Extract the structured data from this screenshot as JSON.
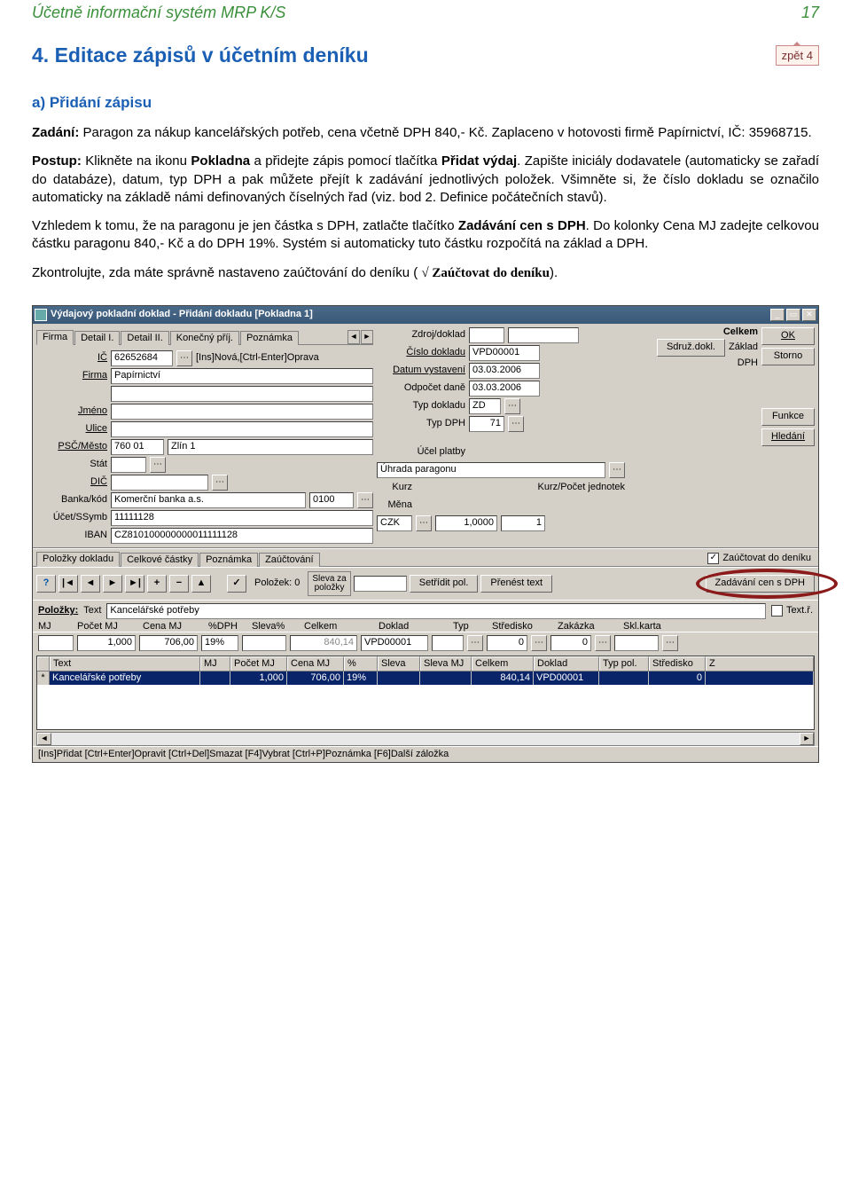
{
  "header": {
    "title": "Účetně informační systém MRP K/S",
    "page": "17"
  },
  "section": "4. Editace zápisů v účetním deníku",
  "back_btn": "zpět 4",
  "subsection": "a) Přidání zápisu",
  "para1_prefix": "Zadání:",
  "para1_body": " Paragon za nákup kancelářských potřeb, cena včetně DPH 840,- Kč. Zaplaceno v hotovosti firmě Papírnictví, IČ: 35968715.",
  "para2_prefix": "Postup:",
  "para2_a": " Klikněte na ikonu ",
  "para2_b": "Pokladna",
  "para2_c": " a přidejte zápis pomocí tlačítka ",
  "para2_d": "Přidat výdaj",
  "para2_e": ". Zapište iniciály dodavatele (automaticky se zařadí do databáze), datum, typ DPH a pak můžete přejít k zadávání jednotlivých položek. Všimněte si, že číslo dokladu se označilo automaticky na základě námi definovaných číselných řad (viz. bod 2. Definice počátečních stavů).",
  "para3_a": "Vzhledem k tomu, že na paragonu je jen částka s DPH, zatlačte tlačítko ",
  "para3_b": "Zadávání cen s DPH",
  "para3_c": ". Do kolonky Cena MJ zadejte celkovou částku paragonu 840,- Kč  a  do DPH 19%. Systém  si automaticky tuto částku rozpočítá na základ a DPH.",
  "para4_a": "Zkontrolujte, zda máte správně nastaveno zaúčtování do deníku ( ",
  "para4_b": "√ Zaúčtovat do deníku",
  "para4_c": ").",
  "win": {
    "title": "Výdajový pokladní doklad - Přidání dokladu  [Pokladna 1]",
    "tabs1": [
      "Firma",
      "Detail I.",
      "Detail II.",
      "Konečný příj.",
      "Poznámka"
    ],
    "left": {
      "ic_label": "IČ",
      "ic": "62652684",
      "ic_hint": "[Ins]Nová,[Ctrl-Enter]Oprava",
      "firma_label": "Firma",
      "firma": "Papírnictví",
      "jmeno_label": "Jméno",
      "jmeno": "",
      "ulice_label": "Ulice",
      "ulice": "",
      "psc_label": "PSČ/Město",
      "psc": "760 01",
      "mesto": "Zlín 1",
      "stat_label": "Stát",
      "stat": "",
      "dic_label": "DIČ",
      "dic": "",
      "banka_label": "Banka/kód",
      "banka": "Komerční banka a.s.",
      "kod": "0100",
      "ucet_label": "Účet/SSymb",
      "ucet": "11111128",
      "iban_label": "IBAN",
      "iban": "CZ810100000000011111128"
    },
    "mid": {
      "zdroj_label": "Zdroj/doklad",
      "cislo_label": "Číslo dokladu",
      "cislo": "VPD00001",
      "datum_label": "Datum vystavení",
      "datum": "03.03.2006",
      "odpocet_label": "Odpočet daně",
      "odpocet": "03.03.2006",
      "typdok_label": "Typ dokladu",
      "typdok": "ZD",
      "typdph_label": "Typ DPH",
      "typdph": "71",
      "ucel_label": "Účel platby",
      "ucel": "Úhrada paragonu",
      "kurz_label": "Kurz",
      "kurz_hint": "Kurz/Počet jednotek",
      "mena_label": "Měna",
      "mena": "CZK",
      "kurz": "1,0000",
      "kurz_units": "1"
    },
    "right": {
      "celkem": "Celkem",
      "sdruz": "Sdruž.dokl.",
      "zaklad": "Základ",
      "dph": "DPH",
      "ok": "OK",
      "storno": "Storno",
      "funkce": "Funkce",
      "hledani": "Hledání"
    },
    "tabs2": [
      "Položky dokladu",
      "Celkové částky",
      "Poznámka",
      "Zaúčtování"
    ],
    "zauctovat_lbl": "Zaúčtovat do deníku",
    "toolbar": {
      "polozek_lbl": "Položek:",
      "polozek": "0",
      "sleva_lbl1": "Sleva za",
      "sleva_lbl2": "položky",
      "setridit": "Setřídit pol.",
      "prenest": "Přenést text",
      "zadavani": "Zadávání cen s DPH"
    },
    "polozky": {
      "label": "Položky:",
      "sub": "Text",
      "text": "Kancelářské potřeby",
      "textr": "Text.ř."
    },
    "num_head": [
      "MJ",
      "Počet MJ",
      "Cena MJ",
      "%DPH",
      "Sleva%",
      "Celkem",
      "Doklad",
      "Typ",
      "Středisko",
      "Zakázka",
      "Skl.karta"
    ],
    "num_vals": {
      "mj": "",
      "pocet": "1,000",
      "cena": "706,00",
      "dph": "19%",
      "sleva": "",
      "celkem": "840,14",
      "doklad": "VPD00001",
      "typ": "",
      "stred": "0",
      "zak": "0",
      "skl": ""
    },
    "grid_head": [
      "",
      "Text",
      "MJ",
      "Počet MJ",
      "Cena MJ",
      "%",
      "Sleva",
      "Sleva MJ",
      "Celkem",
      "Doklad",
      "Typ pol.",
      "Středisko",
      "Z"
    ],
    "grid_row": [
      "*",
      "Kancelářské potřeby",
      "",
      "1,000",
      "706,00",
      "19%",
      "",
      "",
      "840,14",
      "VPD00001",
      "",
      "0",
      ""
    ],
    "status": "[Ins]Přidat [Ctrl+Enter]Opravit [Ctrl+Del]Smazat [F4]Vybrat [Ctrl+P]Poznámka [F6]Další záložka"
  }
}
